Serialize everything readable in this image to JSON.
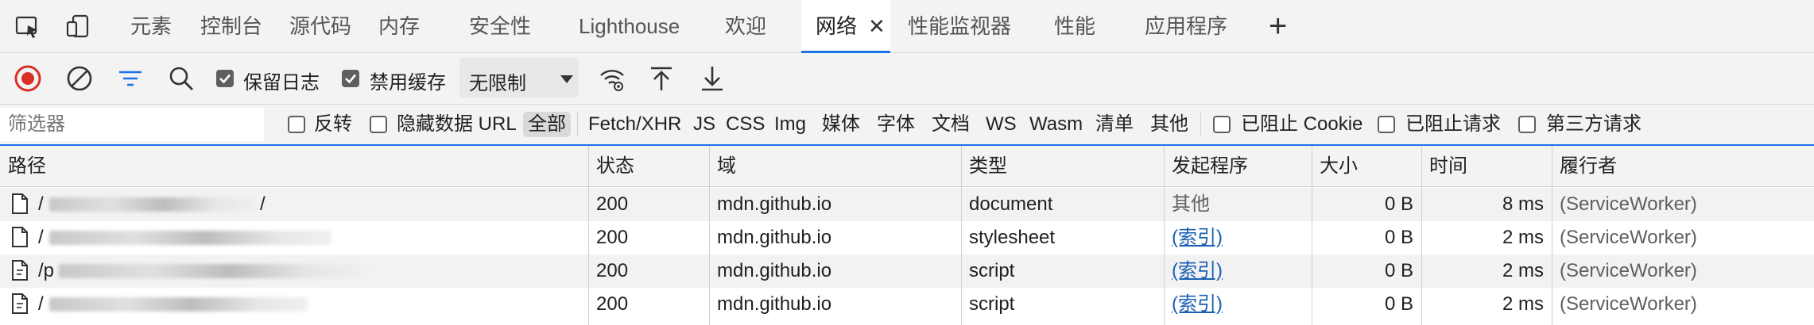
{
  "tabs": {
    "items": [
      {
        "label": "元素"
      },
      {
        "label": "控制台"
      },
      {
        "label": "源代码"
      },
      {
        "label": "内存"
      },
      {
        "label": "安全性"
      },
      {
        "label": "Lighthouse"
      },
      {
        "label": "欢迎"
      },
      {
        "label": "网络",
        "active": true
      },
      {
        "label": "性能监视器"
      },
      {
        "label": "性能"
      },
      {
        "label": "应用程序"
      }
    ],
    "close_label": "✕",
    "add_label": "+",
    "icons": [
      "inspect-element-icon",
      "device-emulation-icon"
    ]
  },
  "toolbar": {
    "preserve_log_label": "保留日志",
    "preserve_log_checked": true,
    "disable_cache_label": "禁用缓存",
    "disable_cache_checked": true,
    "throttling_value": "无限制",
    "colors": {
      "record": "#d93025",
      "filter_active": "#1a73e8"
    }
  },
  "filter": {
    "placeholder": "筛选器",
    "invert_label": "反转",
    "hide_data_url_label": "隐藏数据 URL",
    "types": [
      "全部",
      "Fetch/XHR",
      "JS",
      "CSS",
      "Img",
      "媒体",
      "字体",
      "文档",
      "WS",
      "Wasm",
      "清单",
      "其他"
    ],
    "selected_type": "全部",
    "blocked_cookies_label": "已阻止 Cookie",
    "blocked_requests_label": "已阻止请求",
    "third_party_label": "第三方请求"
  },
  "table": {
    "columns": [
      "路径",
      "状态",
      "域",
      "类型",
      "发起程序",
      "大小",
      "时间",
      "履行者"
    ],
    "rows": [
      {
        "path": "/",
        "status": "200",
        "domain": "mdn.github.io",
        "type": "document",
        "initiator": "其他",
        "initiator_link": false,
        "size": "0 B",
        "time": "8 ms",
        "fulfilled": "(ServiceWorker)"
      },
      {
        "path": "/",
        "status": "200",
        "domain": "mdn.github.io",
        "type": "stylesheet",
        "initiator": "(索引)",
        "initiator_link": true,
        "size": "0 B",
        "time": "2 ms",
        "fulfilled": "(ServiceWorker)"
      },
      {
        "path": "/p",
        "status": "200",
        "domain": "mdn.github.io",
        "type": "script",
        "initiator": "(索引)",
        "initiator_link": true,
        "size": "0 B",
        "time": "2 ms",
        "fulfilled": "(ServiceWorker)"
      },
      {
        "path": "/",
        "status": "200",
        "domain": "mdn.github.io",
        "type": "script",
        "initiator": "(索引)",
        "initiator_link": true,
        "size": "0 B",
        "time": "2 ms",
        "fulfilled": "(ServiceWorker)"
      }
    ]
  }
}
